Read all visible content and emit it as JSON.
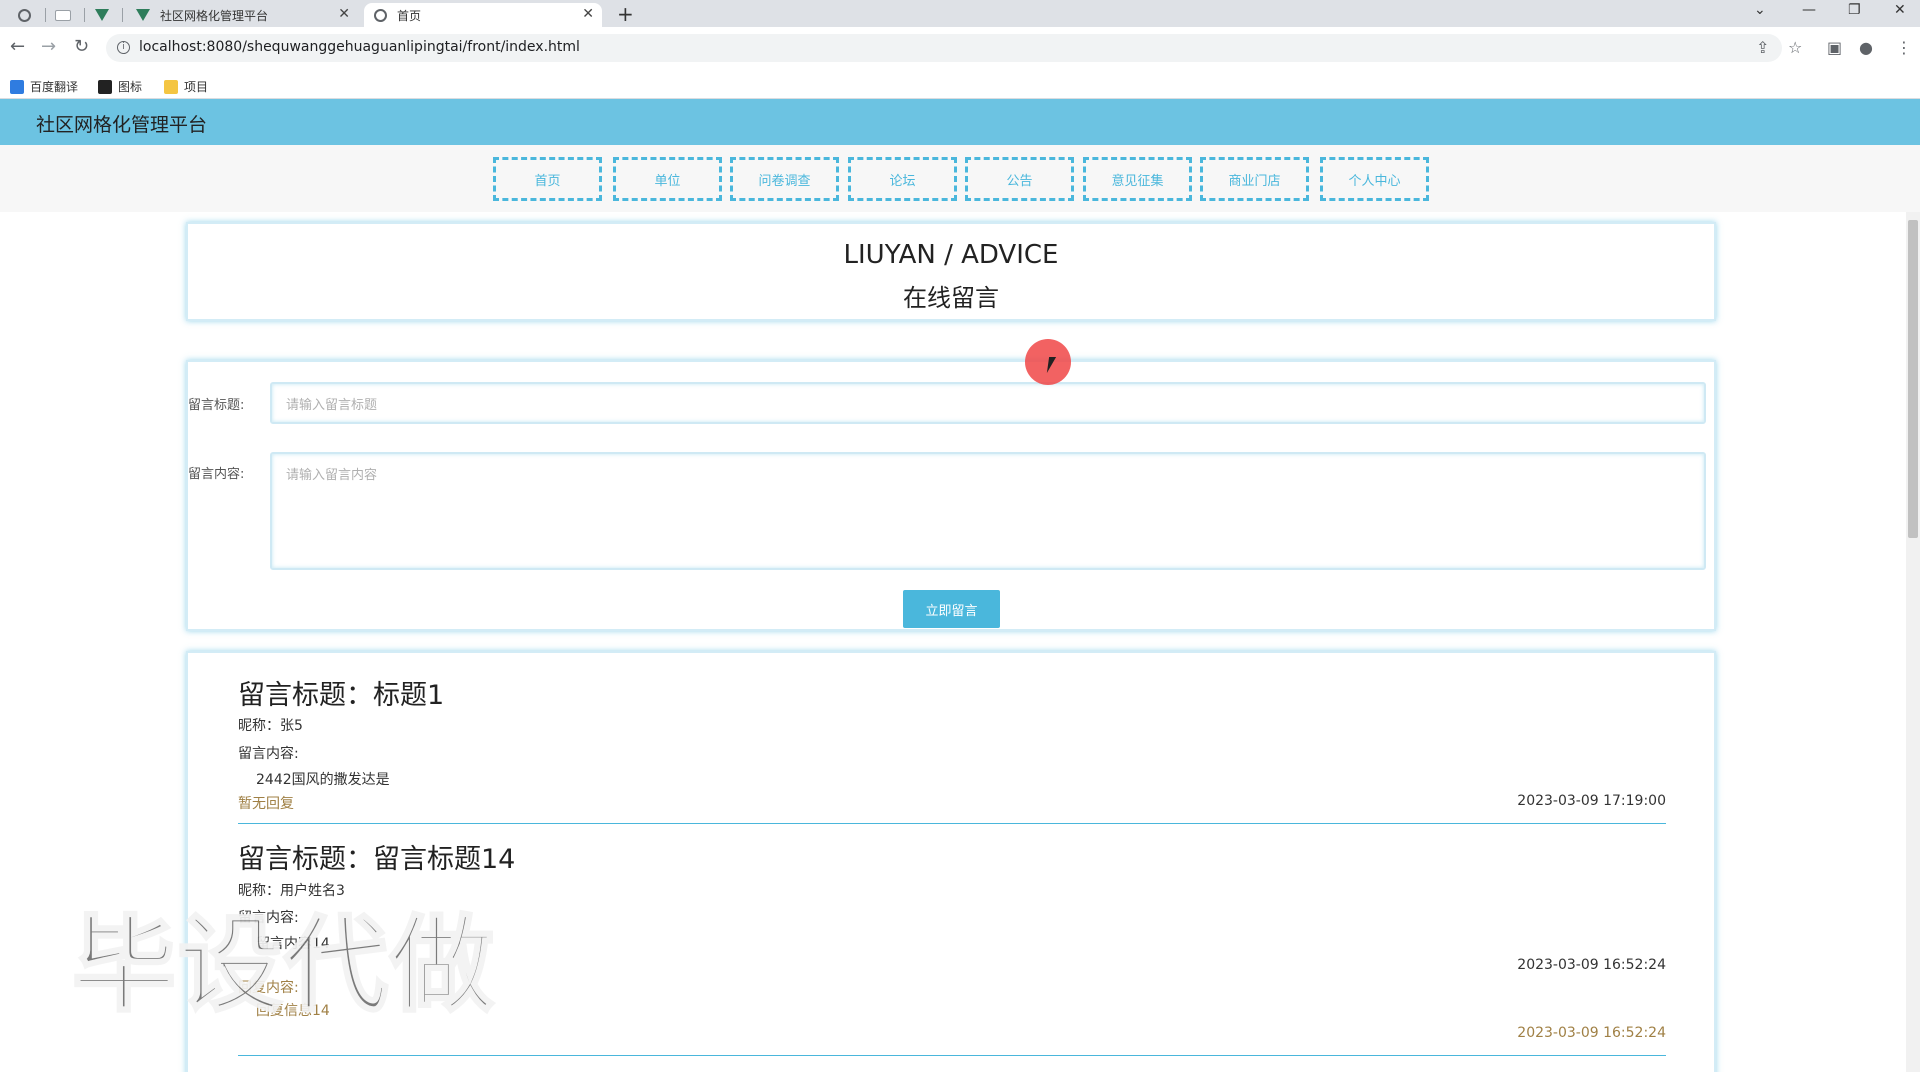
{
  "browser": {
    "tabs": [
      {
        "title": "社区网格化管理平台",
        "active": false
      },
      {
        "title": "首页",
        "active": true
      }
    ],
    "url": "localhost:8080/shequwanggehuaguanlipingtai/front/index.html",
    "bookmarks": [
      "百度翻译",
      "图标",
      "项目"
    ]
  },
  "site": {
    "title": "社区网格化管理平台",
    "nav": [
      "首页",
      "单位",
      "问卷调查",
      "论坛",
      "公告",
      "意见征集",
      "商业门店",
      "个人中心"
    ]
  },
  "heading": {
    "en": "LIUYAN / ADVICE",
    "cn": "在线留言"
  },
  "form": {
    "title_label": "留言标题:",
    "title_placeholder": "请输入留言标题",
    "content_label": "留言内容:",
    "content_placeholder": "请输入留言内容",
    "submit_label": "立即留言"
  },
  "messages": [
    {
      "title": "留言标题：标题1",
      "nickname": "昵称：张5",
      "content_label": "留言内容:",
      "content": "2442国风的撒发达是",
      "reply_status": "暂无回复",
      "time": "2023-03-09 17:19:00"
    },
    {
      "title": "留言标题：留言标题14",
      "nickname": "昵称：用户姓名3",
      "content_label": "留言内容:",
      "content": "留言内容14",
      "time": "2023-03-09 16:52:24",
      "reply_label": "回复内容:",
      "reply": "回复信息14",
      "reply_time": "2023-03-09 16:52:24"
    }
  ],
  "watermark": "毕设代做",
  "colors": {
    "header": "#6cc3e2",
    "accent": "#4ab7dc",
    "reply": "#a08045"
  }
}
